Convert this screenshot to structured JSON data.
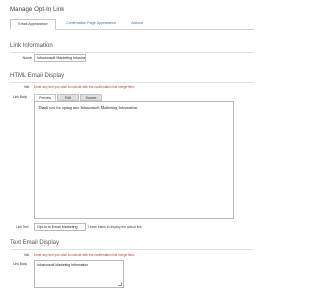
{
  "page": {
    "title": "Manage Opt-In Link"
  },
  "tabs": [
    {
      "label": "Email Appearance"
    },
    {
      "label": "Confirmation Page Appearance"
    },
    {
      "label": "Actions"
    }
  ],
  "link_info": {
    "heading": "Link Information",
    "name_label": "Name",
    "name_value": "Infusionsoft Marketing Information"
  },
  "html_email": {
    "heading": "HTML Email Display",
    "info_label": "Info",
    "info_text": "Enter any text you wish to include with the confirmation link merge field.",
    "link_body_label": "Link Body",
    "subtabs": [
      {
        "label": "Preview"
      },
      {
        "label": "Edit"
      },
      {
        "label": "Source"
      }
    ],
    "editor_text": "Thank you for opting into Infusionsoft Marketing Information",
    "link_text_label": "Link Text",
    "link_text_value": "Opt-in to Email Marketing",
    "link_text_help": "Leave blank to display the actual link."
  },
  "text_email": {
    "heading": "Text Email Display",
    "info_label": "Info",
    "info_text": "Enter any text you wish to include with the confirmation link merge field.",
    "link_body_label": "Link Body",
    "link_body_value": "Infusionsoft Marketing Information"
  }
}
